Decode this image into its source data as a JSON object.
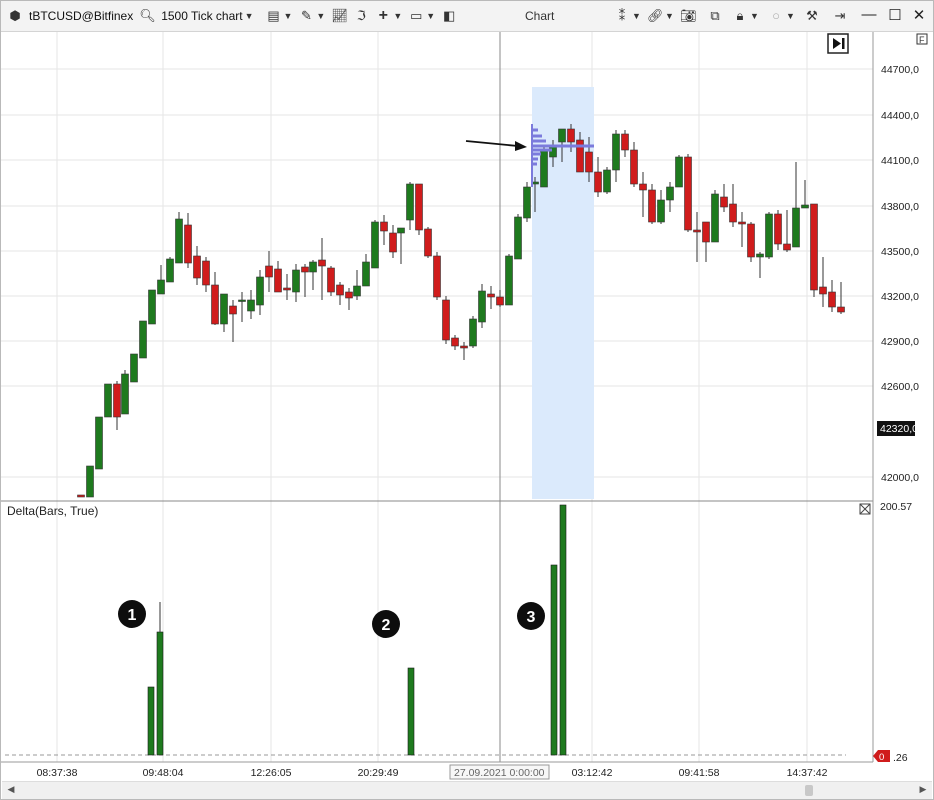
{
  "toolbar": {
    "symbol": "tBTCUSD@Bitfinex",
    "chart_type": "1500 Tick chart",
    "title": "Chart"
  },
  "price_axis": {
    "labels": [
      "44700,0",
      "44400,0",
      "44100,0",
      "43800,0",
      "43500,0",
      "43200,0",
      "42900,0",
      "42600,0",
      "42000,0"
    ],
    "current_price": "42320,0"
  },
  "delta_panel": {
    "title": "Delta(Bars, True)",
    "max_label": "200.57",
    "zero_badge": "0",
    "zero_label": ".26",
    "markers": [
      "1",
      "2",
      "3"
    ]
  },
  "time_axis": {
    "labels": [
      "08:37:38",
      "09:48:04",
      "12:26:05",
      "20:29:49",
      "03:12:42",
      "09:41:58",
      "14:37:42"
    ],
    "cursor_label": "27.09.2021 0:00:00"
  },
  "colors": {
    "up": "#1e7a1e",
    "down": "#d01c1c",
    "highlight": "#dbeafc",
    "profile": "#7b7bdc",
    "grid": "#e6e6e6"
  }
}
